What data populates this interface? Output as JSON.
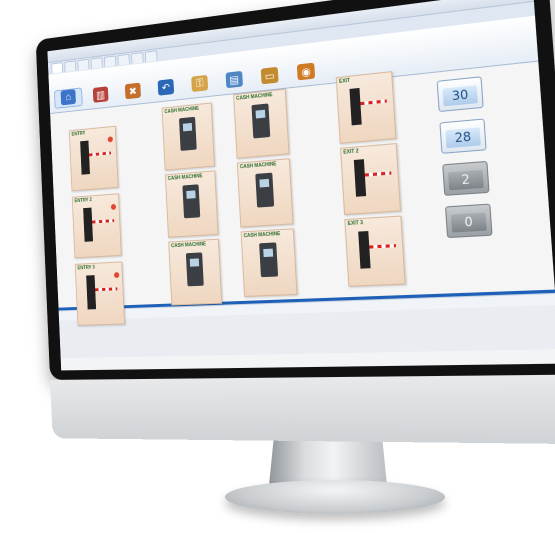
{
  "tabs": [
    "",
    "",
    "",
    "",
    "",
    "",
    "",
    ""
  ],
  "ribbon": [
    {
      "icon": "home-icon",
      "label": "",
      "color": "#3d73c8"
    },
    {
      "icon": "machine-icon",
      "label": "",
      "color": "#b7423a"
    },
    {
      "icon": "delete-icon",
      "label": "",
      "color": "#c46f2a"
    },
    {
      "icon": "undo-icon",
      "label": "",
      "color": "#2b67b7"
    },
    {
      "icon": "key-icon",
      "label": "",
      "color": "#d4a447"
    },
    {
      "icon": "report-icon",
      "label": "",
      "color": "#4f86c6"
    },
    {
      "icon": "card-icon",
      "label": "",
      "color": "#c48b2e"
    },
    {
      "icon": "coin-icon",
      "label": "",
      "color": "#cf7a24"
    }
  ],
  "cards": {
    "entry1": {
      "title": "ENTRY",
      "caption": ""
    },
    "entry2": {
      "title": "ENTRY 2",
      "caption": ""
    },
    "entry3": {
      "title": "ENTRY 3",
      "caption": ""
    },
    "cash1": {
      "title": "CASH MACHINE",
      "caption": ""
    },
    "cash2": {
      "title": "CASH MACHINE",
      "caption": ""
    },
    "cash3": {
      "title": "CASH MACHINE",
      "caption": ""
    },
    "cash4": {
      "title": "CASH MACHINE",
      "caption": ""
    },
    "cash5": {
      "title": "CASH MACHINE",
      "caption": ""
    },
    "cash6": {
      "title": "CASH MACHINE",
      "caption": ""
    },
    "exit1": {
      "title": "EXIT",
      "caption": ""
    },
    "exit2": {
      "title": "EXIT 2",
      "caption": ""
    },
    "exit3": {
      "title": "EXIT 3",
      "caption": ""
    }
  },
  "counters": {
    "c1": {
      "label": "",
      "value": "30"
    },
    "c2": {
      "label": "",
      "value": "28"
    },
    "c3": {
      "label": "",
      "value": "2"
    },
    "c4": {
      "label": "",
      "value": "0"
    }
  },
  "status": {
    "left": "",
    "mid": "",
    "right": "",
    "far": ""
  }
}
